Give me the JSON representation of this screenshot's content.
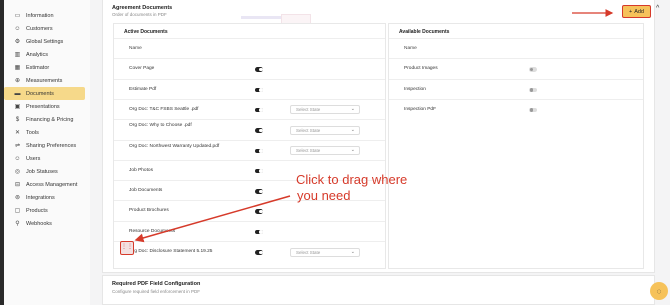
{
  "sidebar": {
    "items": [
      {
        "label": "Information",
        "icon": "id-card-icon",
        "glyph": "▭"
      },
      {
        "label": "Customers",
        "icon": "user-icon",
        "glyph": "☺"
      },
      {
        "label": "Global Settings",
        "icon": "gear-icon",
        "glyph": "⚙"
      },
      {
        "label": "Analytics",
        "icon": "bar-chart-icon",
        "glyph": "▥"
      },
      {
        "label": "Estimator",
        "icon": "calculator-icon",
        "glyph": "▦"
      },
      {
        "label": "Measurements",
        "icon": "ruler-icon",
        "glyph": "⊕"
      },
      {
        "label": "Documents",
        "icon": "folder-icon",
        "glyph": "▬",
        "active": true
      },
      {
        "label": "Presentations",
        "icon": "presentation-icon",
        "glyph": "▣"
      },
      {
        "label": "Financing & Pricing",
        "icon": "dollar-icon",
        "glyph": "$"
      },
      {
        "label": "Tools",
        "icon": "wrench-icon",
        "glyph": "✕"
      },
      {
        "label": "Sharing Preferences",
        "icon": "share-icon",
        "glyph": "⇌"
      },
      {
        "label": "Users",
        "icon": "users-icon",
        "glyph": "☺"
      },
      {
        "label": "Job Statuses",
        "icon": "status-icon",
        "glyph": "◎"
      },
      {
        "label": "Access Management",
        "icon": "lock-icon",
        "glyph": "⊟"
      },
      {
        "label": "Integrations",
        "icon": "integrations-icon",
        "glyph": "⊚"
      },
      {
        "label": "Products",
        "icon": "box-icon",
        "glyph": "▢"
      },
      {
        "label": "Webhooks",
        "icon": "webhook-icon",
        "glyph": "⚲"
      }
    ]
  },
  "agreement": {
    "title": "Agreement Documents",
    "subtitle": "Order of documents in PDF",
    "add_label": "Add",
    "add_glyph": "+",
    "collapse_glyph": "^"
  },
  "active": {
    "heading": "Active Documents",
    "name_header": "Name",
    "select_placeholder": "Select State",
    "rows": [
      {
        "name": "Cover Page",
        "toggle": "on",
        "has_select": false
      },
      {
        "name": "Estimate Pdf",
        "toggle": "on",
        "has_select": false
      },
      {
        "name": "Org Doc: T&C FSBS Seattle .pdf",
        "toggle": "on",
        "has_select": true
      },
      {
        "name": "Org Doc: Why to Choose                 .pdf",
        "toggle": "on",
        "has_select": true
      },
      {
        "name": "Org Doc:                         Northwest Warranty Updated.pdf",
        "toggle": "on",
        "has_select": true
      },
      {
        "name": "Job Photos",
        "toggle": "on",
        "has_select": false
      },
      {
        "name": "Job Documents",
        "toggle": "on",
        "has_select": false
      },
      {
        "name": "Product Brochures",
        "toggle": "on",
        "has_select": false
      },
      {
        "name": "Resource Documents",
        "toggle": "on",
        "has_select": false
      },
      {
        "name": "Org Doc: Disclosure Statement 5.19.25",
        "toggle": "on",
        "has_select": true
      }
    ]
  },
  "available": {
    "heading": "Available Documents",
    "name_header": "Name",
    "rows": [
      {
        "name": "Product Images",
        "toggle": "off"
      },
      {
        "name": "Inspection",
        "toggle": "off"
      },
      {
        "name": "Inspection PdF",
        "toggle": "off"
      }
    ]
  },
  "required": {
    "title": "Required PDF Field Configuration",
    "subtitle": "Configure required field enforcement in PDF"
  },
  "annotation": {
    "text_line1": "Click to drag where",
    "text_line2": "you need",
    "color": "#d63a2a"
  },
  "drag_glyph": "⋮⋮",
  "chat_glyph": "◌"
}
